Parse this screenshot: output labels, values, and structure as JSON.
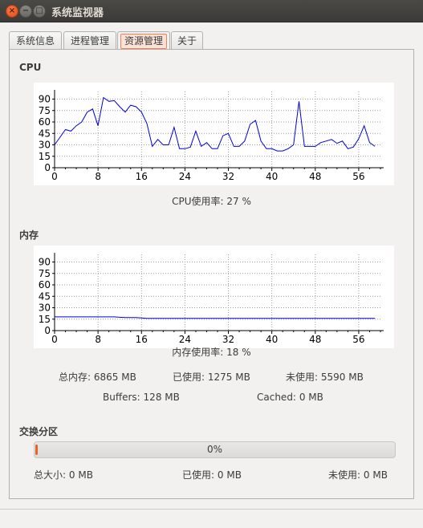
{
  "window": {
    "title": "系统监视器",
    "close_icon": "×",
    "min_icon": "−",
    "max_icon": "□"
  },
  "tabs": [
    {
      "label": "系统信息",
      "active": false
    },
    {
      "label": "进程管理",
      "active": false
    },
    {
      "label": "资源管理",
      "active": true
    },
    {
      "label": "关于",
      "active": false
    }
  ],
  "cpu": {
    "title": "CPU",
    "usage_label": "CPU使用率:",
    "usage_value": "27",
    "usage_unit": "%"
  },
  "memory": {
    "title": "内存",
    "usage_label": "内存使用率:",
    "usage_value": "18",
    "usage_unit": "%",
    "total_label": "总内存:",
    "total_value": "6865",
    "total_unit": "MB",
    "used_label": "已使用:",
    "used_value": "1275",
    "used_unit": "MB",
    "free_label": "未使用:",
    "free_value": "5590",
    "free_unit": "MB",
    "buffers_label": "Buffers:",
    "buffers_value": "128",
    "buffers_unit": "MB",
    "cached_label": "Cached:",
    "cached_value": "0",
    "cached_unit": "MB"
  },
  "swap": {
    "title": "交换分区",
    "percent_text": "0%",
    "percent": 0,
    "total_label": "总大小:",
    "total_value": "0",
    "total_unit": "MB",
    "used_label": "已使用:",
    "used_value": "0",
    "used_unit": "MB",
    "free_label": "未使用:",
    "free_value": "0",
    "free_unit": "MB"
  },
  "colors": {
    "line": "#0000e0",
    "accent": "#e9825d",
    "swap_fill": "#e7612a"
  },
  "chart_data": [
    {
      "type": "line",
      "name": "cpu",
      "x": [
        0,
        1,
        2,
        3,
        4,
        5,
        6,
        7,
        8,
        9,
        10,
        11,
        12,
        13,
        14,
        15,
        16,
        17,
        18,
        19,
        20,
        21,
        22,
        23,
        24,
        25,
        26,
        27,
        28,
        29,
        30,
        31,
        32,
        33,
        34,
        35,
        36,
        37,
        38,
        39,
        40,
        41,
        42,
        43,
        44,
        45,
        46,
        47,
        48,
        49,
        50,
        51,
        52,
        53,
        54,
        55,
        56,
        57,
        58,
        59
      ],
      "y": [
        30,
        40,
        50,
        48,
        55,
        60,
        73,
        77,
        55,
        92,
        87,
        88,
        80,
        73,
        82,
        80,
        73,
        58,
        28,
        37,
        30,
        30,
        53,
        25,
        25,
        27,
        48,
        28,
        33,
        25,
        25,
        42,
        45,
        28,
        28,
        35,
        57,
        62,
        35,
        25,
        25,
        22,
        22,
        25,
        30,
        87,
        28,
        28,
        28,
        33,
        35,
        37,
        32,
        35,
        25,
        27,
        38,
        55,
        33,
        28
      ],
      "xticks": [
        0,
        8,
        16,
        24,
        32,
        40,
        48,
        56
      ],
      "yticks": [
        0,
        15,
        30,
        45,
        60,
        75,
        90
      ],
      "xlim": [
        0,
        60
      ],
      "ylim": [
        0,
        100
      ],
      "grid": true
    },
    {
      "type": "line",
      "name": "memory",
      "x": [
        0,
        1,
        2,
        3,
        4,
        5,
        6,
        7,
        8,
        9,
        10,
        11,
        12,
        13,
        14,
        15,
        16,
        17,
        18,
        19,
        20,
        21,
        22,
        23,
        24,
        25,
        26,
        27,
        28,
        29,
        30,
        31,
        32,
        33,
        34,
        35,
        36,
        37,
        38,
        39,
        40,
        41,
        42,
        43,
        44,
        45,
        46,
        47,
        48,
        49,
        50,
        51,
        52,
        53,
        54,
        55,
        56,
        57,
        58,
        59
      ],
      "y": [
        18,
        18,
        18,
        18,
        18,
        18,
        18,
        18,
        18,
        18,
        18,
        18,
        17.5,
        17,
        17,
        17,
        16.5,
        16,
        16,
        16,
        16,
        16,
        16,
        16,
        16,
        16,
        16,
        16,
        16,
        16,
        16,
        16,
        16,
        16,
        16,
        16,
        16,
        16,
        16,
        16,
        16,
        16,
        16,
        16,
        16,
        16,
        16,
        16,
        16,
        16,
        16,
        16,
        16,
        16,
        16,
        16,
        16,
        16,
        16,
        16
      ],
      "xticks": [
        0,
        8,
        16,
        24,
        32,
        40,
        48,
        56
      ],
      "yticks": [
        0,
        15,
        30,
        45,
        60,
        75,
        90
      ],
      "xlim": [
        0,
        60
      ],
      "ylim": [
        0,
        100
      ],
      "grid": true
    }
  ]
}
